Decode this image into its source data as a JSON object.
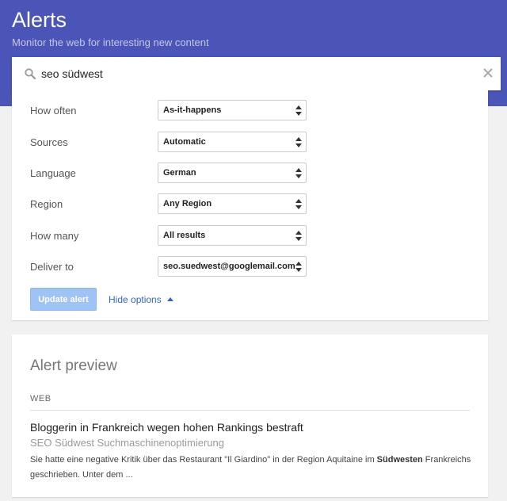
{
  "header": {
    "title": "Alerts",
    "subtitle": "Monitor the web for interesting new content"
  },
  "search": {
    "query": "seo südwest",
    "icon": "search-icon",
    "clear_icon": "close-icon"
  },
  "options": [
    {
      "label": "How often",
      "value": "As-it-happens"
    },
    {
      "label": "Sources",
      "value": "Automatic"
    },
    {
      "label": "Language",
      "value": "German"
    },
    {
      "label": "Region",
      "value": "Any Region"
    },
    {
      "label": "How many",
      "value": "All results"
    },
    {
      "label": "Deliver to",
      "value": "seo.suedwest@googlemail.com"
    }
  ],
  "actions": {
    "update_label": "Update alert",
    "hide_options_label": "Hide options"
  },
  "preview": {
    "title": "Alert preview",
    "section_label": "WEB",
    "result": {
      "title": "Bloggerin in Frankreich wegen hohen Rankings bestraft",
      "source": "SEO Südwest Suchmaschinenoptimierung",
      "snippet_before": "Sie hatte eine negative Kritik über das Restaurant \"Il Giardino\" in der Region Aquitaine im ",
      "snippet_bold": "Südwesten",
      "snippet_after": " Frankreichs geschrieben. Unter dem ..."
    }
  },
  "colors": {
    "header_bg": "#4b55b8",
    "link": "#3366cc",
    "button_disabled": "#a0c3f5"
  }
}
